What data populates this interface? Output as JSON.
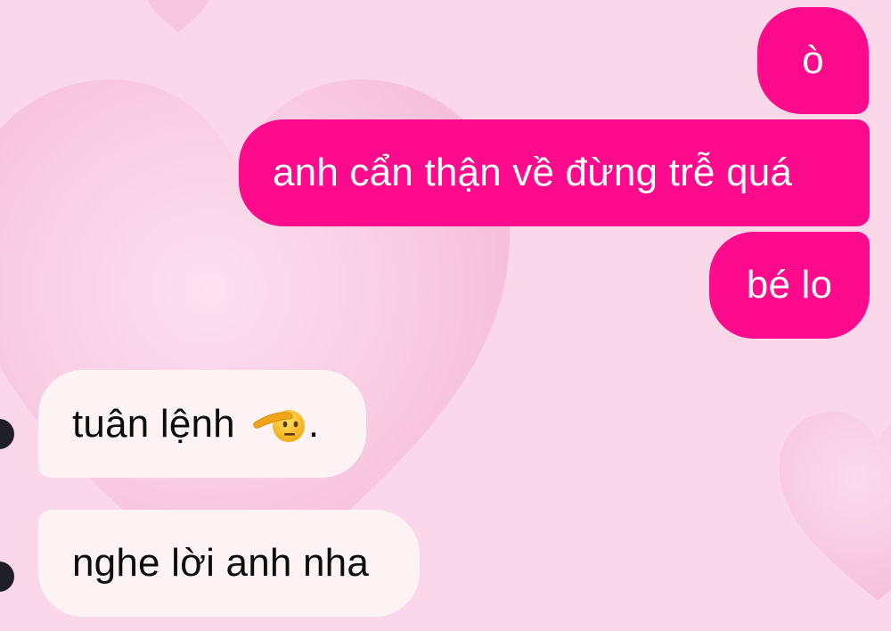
{
  "messages": [
    {
      "id": "m1",
      "side": "sent",
      "text": "ò"
    },
    {
      "id": "m2",
      "side": "sent",
      "text": "anh cẩn thận về đừng trễ quá"
    },
    {
      "id": "m3",
      "side": "sent",
      "text": "bé lo"
    },
    {
      "id": "m4",
      "side": "received",
      "text": "tuân lệnh",
      "emoji": "saluting-face-icon",
      "suffix": "."
    },
    {
      "id": "m5",
      "side": "received",
      "text": "nghe lời anh nha"
    }
  ],
  "colors": {
    "sent_bubble": "#fe0a8c",
    "sent_text": "#ffffff",
    "received_bubble": "#fdf2f4",
    "received_text": "#0d0d0d",
    "background": "#fbd7ea",
    "avatar": "#1f1f28"
  }
}
